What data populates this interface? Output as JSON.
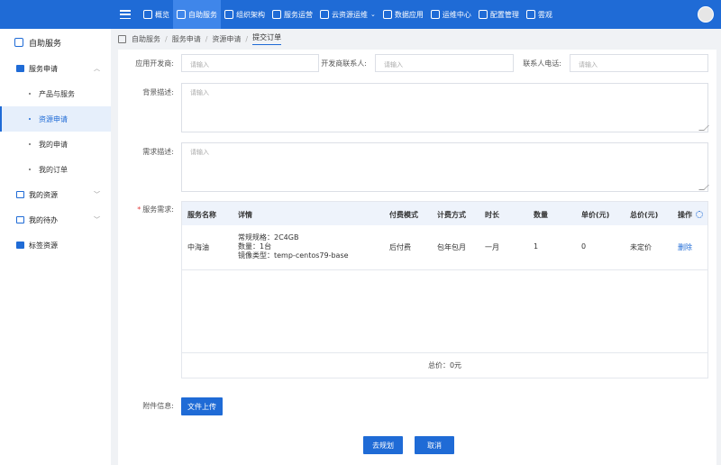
{
  "nav": {
    "items": [
      {
        "label": "概览",
        "icon": "home-icon"
      },
      {
        "label": "自助服务",
        "icon": "user-icon",
        "active": true
      },
      {
        "label": "组织架构",
        "icon": "cube-icon"
      },
      {
        "label": "服务运营",
        "icon": "image-icon"
      },
      {
        "label": "云资源运维",
        "icon": "cloud-icon",
        "dropdown": true
      },
      {
        "label": "数据应用",
        "icon": "bar-chart-icon"
      },
      {
        "label": "运维中心",
        "icon": "monitor-icon"
      },
      {
        "label": "配置管理",
        "icon": "settings-icon"
      },
      {
        "label": "雲观",
        "icon": "grid-icon"
      }
    ]
  },
  "sidebar": {
    "title": "自助服务",
    "groups": [
      {
        "label": "服务申请",
        "expanded": true,
        "sub": [
          "产品与服务",
          "资源申请",
          "我的申请",
          "我的订单"
        ],
        "active_sub": 1
      },
      {
        "label": "我的资源"
      },
      {
        "label": "我的待办"
      },
      {
        "label": "标签资源"
      }
    ]
  },
  "breadcrumb": [
    "自助服务",
    "服务申请",
    "资源申请",
    "提交订单"
  ],
  "form": {
    "app_developer": {
      "label": "应用开发商:",
      "placeholder": "请输入"
    },
    "dev_contact": {
      "label": "开发商联系人:",
      "placeholder": "请输入"
    },
    "contact_phone": {
      "label": "联系人电话:",
      "placeholder": "请输入"
    },
    "background": {
      "label": "背景描述:",
      "placeholder": "请输入"
    },
    "requirement": {
      "label": "需求描述:",
      "placeholder": "请输入"
    },
    "service_req": {
      "label": "服务需求:",
      "required_mark": "*"
    },
    "attachment": {
      "label": "附件信息:",
      "upload_button": "文件上传"
    }
  },
  "table": {
    "headers": [
      "服务名称",
      "详情",
      "付费模式",
      "计费方式",
      "时长",
      "数量",
      "单价(元)",
      "总价(元)",
      "操作"
    ],
    "rows": [
      {
        "name": "中海油",
        "detail": [
          "常规规格：2C4GB",
          "数量：1台",
          "镜像类型：temp-centos79-base"
        ],
        "pay_mode": "后付费",
        "billing": "包年包月",
        "duration": "一月",
        "qty": "1",
        "unit_price": "0",
        "total_price": "未定价",
        "action": "删除"
      }
    ],
    "total": "总价：0元"
  },
  "buttons": {
    "plan": "去规划",
    "cancel": "取消"
  },
  "colors": {
    "primary": "#1f6bd6",
    "nav_active": "#3f86ea",
    "required": "#e23c3c"
  }
}
